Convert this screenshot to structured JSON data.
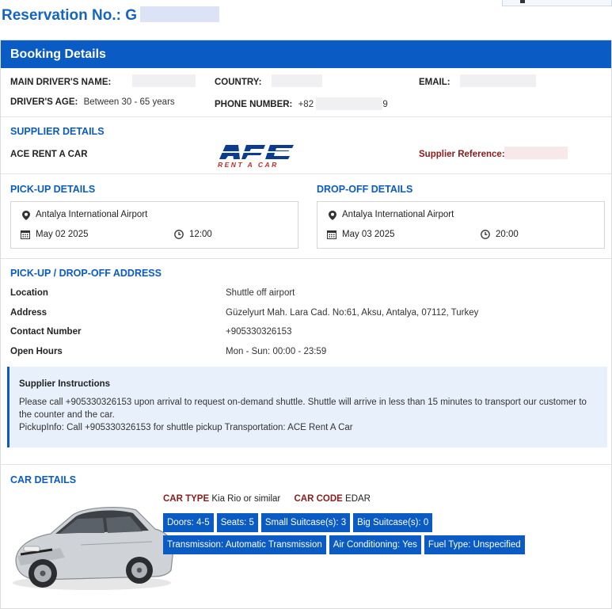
{
  "reservation": {
    "title": "Reservation No.: G"
  },
  "card": {
    "header": "Booking Details"
  },
  "driver": {
    "name_label": "MAIN DRIVER'S NAME:",
    "country_label": "COUNTRY:",
    "email_label": "EMAIL:",
    "age_label": "DRIVER'S AGE:",
    "age_value": "Between 30 - 65 years",
    "phone_label": "PHONE NUMBER:",
    "phone_value": "+82",
    "phone_tail": "9"
  },
  "supplier": {
    "section_title": "SUPPLIER DETAILS",
    "name": "ACE RENT A CAR",
    "logo_text": "ACE",
    "logo_sub": "RENT A CAR",
    "reference_label": "Supplier Reference:"
  },
  "pickup": {
    "section_title": "PICK-UP DETAILS",
    "location": "Antalya International Airport",
    "date": "May 02 2025",
    "time": "12:00"
  },
  "dropoff": {
    "section_title": "DROP-OFF DETAILS",
    "location": "Antalya International Airport",
    "date": "May 03 2025",
    "time": "20:00"
  },
  "address": {
    "section_title": "PICK-UP / DROP-OFF ADDRESS",
    "rows": [
      {
        "key": "Location",
        "value": "Shuttle off airport"
      },
      {
        "key": "Address",
        "value": "Güzelyurt Mah. Lara Cad. No:61, Aksu, Antalya, 07112, Turkey"
      },
      {
        "key": "Contact Number",
        "value": "+905330326153"
      },
      {
        "key": "Open Hours",
        "value": "Mon - Sun: 00:00 - 23:59"
      }
    ]
  },
  "instructions": {
    "title": "Supplier Instructions",
    "line1": "Please call +905330326153 upon arrival to request on-demand shuttle. Shuttle will arrive in less than 15 minutes to transport our customer to the counter and the car.",
    "line2": "PickupInfo: Call +905330326153 for shuttle pickup Transportation: ACE Rent A Car"
  },
  "car": {
    "section_title": "CAR DETAILS",
    "type_label": "CAR TYPE",
    "type_value": "Kia Rio or similar",
    "code_label": "CAR CODE",
    "code_value": "EDAR",
    "chips_row1": [
      "Doors: 4-5",
      "Seats: 5",
      "Small Suitcase(s): 3",
      "Big Suitcase(s): 0"
    ],
    "chips_row2": [
      "Transmission: Automatic Transmission",
      "Air Conditioning: Yes",
      "Fuel Type: Unspecified"
    ]
  },
  "icons": {
    "location": "map-pin-icon",
    "calendar": "calendar-icon",
    "clock": "clock-icon"
  },
  "colors": {
    "brand_blue": "#0a5bc4",
    "title_blue": "#1565c0",
    "car_label_red": "#8b1a1a",
    "instructions_bg": "#e8f1fb",
    "ace_red": "#c62828"
  }
}
